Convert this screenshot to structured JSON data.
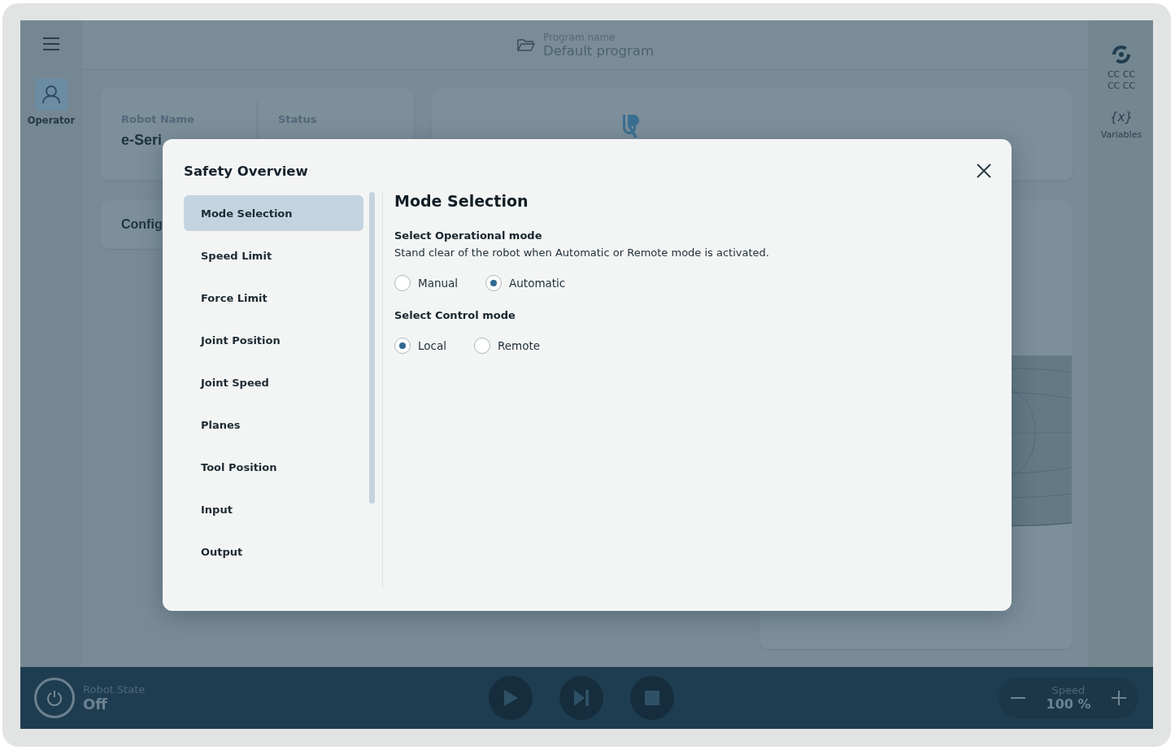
{
  "left_rail": {
    "items": [
      {
        "label": "Operator",
        "selected": true
      }
    ]
  },
  "header": {
    "program_label": "Program name",
    "program_name": "Default program"
  },
  "robot_card": {
    "fields": [
      {
        "label": "Robot Name",
        "value": "e-Seri"
      },
      {
        "label": "Status"
      }
    ]
  },
  "config_card": {
    "title": "Config"
  },
  "right_rail": {
    "items": [
      {
        "kind": "swirl",
        "lines": [
          "CC CC",
          "CC CC"
        ]
      },
      {
        "kind": "variables",
        "icon_text": "{x}",
        "lines": [
          "Variables"
        ]
      }
    ]
  },
  "bottom_bar": {
    "state_label": "Robot State",
    "state": "Off",
    "speed_label": "Speed",
    "speed": "100 %"
  },
  "modal": {
    "title": "Safety Overview",
    "nav": [
      {
        "label": "Mode Selection",
        "selected": true
      },
      {
        "label": "Speed Limit",
        "selected": false
      },
      {
        "label": "Force Limit",
        "selected": false
      },
      {
        "label": "Joint Position",
        "selected": false
      },
      {
        "label": "Joint Speed",
        "selected": false
      },
      {
        "label": "Planes",
        "selected": false
      },
      {
        "label": "Tool Position",
        "selected": false
      },
      {
        "label": "Input",
        "selected": false
      },
      {
        "label": "Output",
        "selected": false
      }
    ],
    "heading": "Mode Selection",
    "groups": [
      {
        "title": "Select Operational mode",
        "description": "Stand clear of the robot when Automatic or Remote mode is activated.",
        "options": [
          {
            "label": "Manual",
            "selected": false
          },
          {
            "label": "Automatic",
            "selected": true
          }
        ]
      },
      {
        "title": "Select Control mode",
        "options": [
          {
            "label": "Local",
            "selected": true
          },
          {
            "label": "Remote",
            "selected": false
          }
        ]
      }
    ]
  }
}
